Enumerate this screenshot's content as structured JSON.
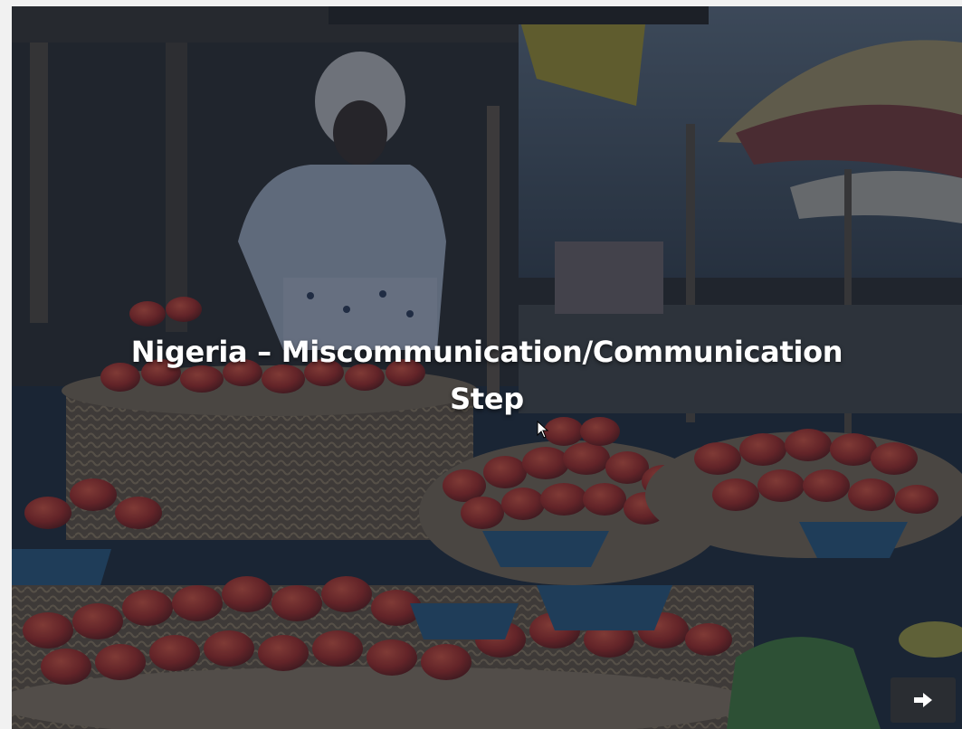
{
  "slide": {
    "title": "Nigeria – Miscommunication/Communication Step"
  },
  "controls": {
    "next_icon": "arrow-right-icon"
  },
  "colors": {
    "overlay": "#162032",
    "title_text": "#ffffff",
    "next_button_bg": "#2a2d32",
    "pepper_red": "#c0281e",
    "basket_tan": "#8a7458",
    "bowl_blue": "#2b5f8a"
  }
}
